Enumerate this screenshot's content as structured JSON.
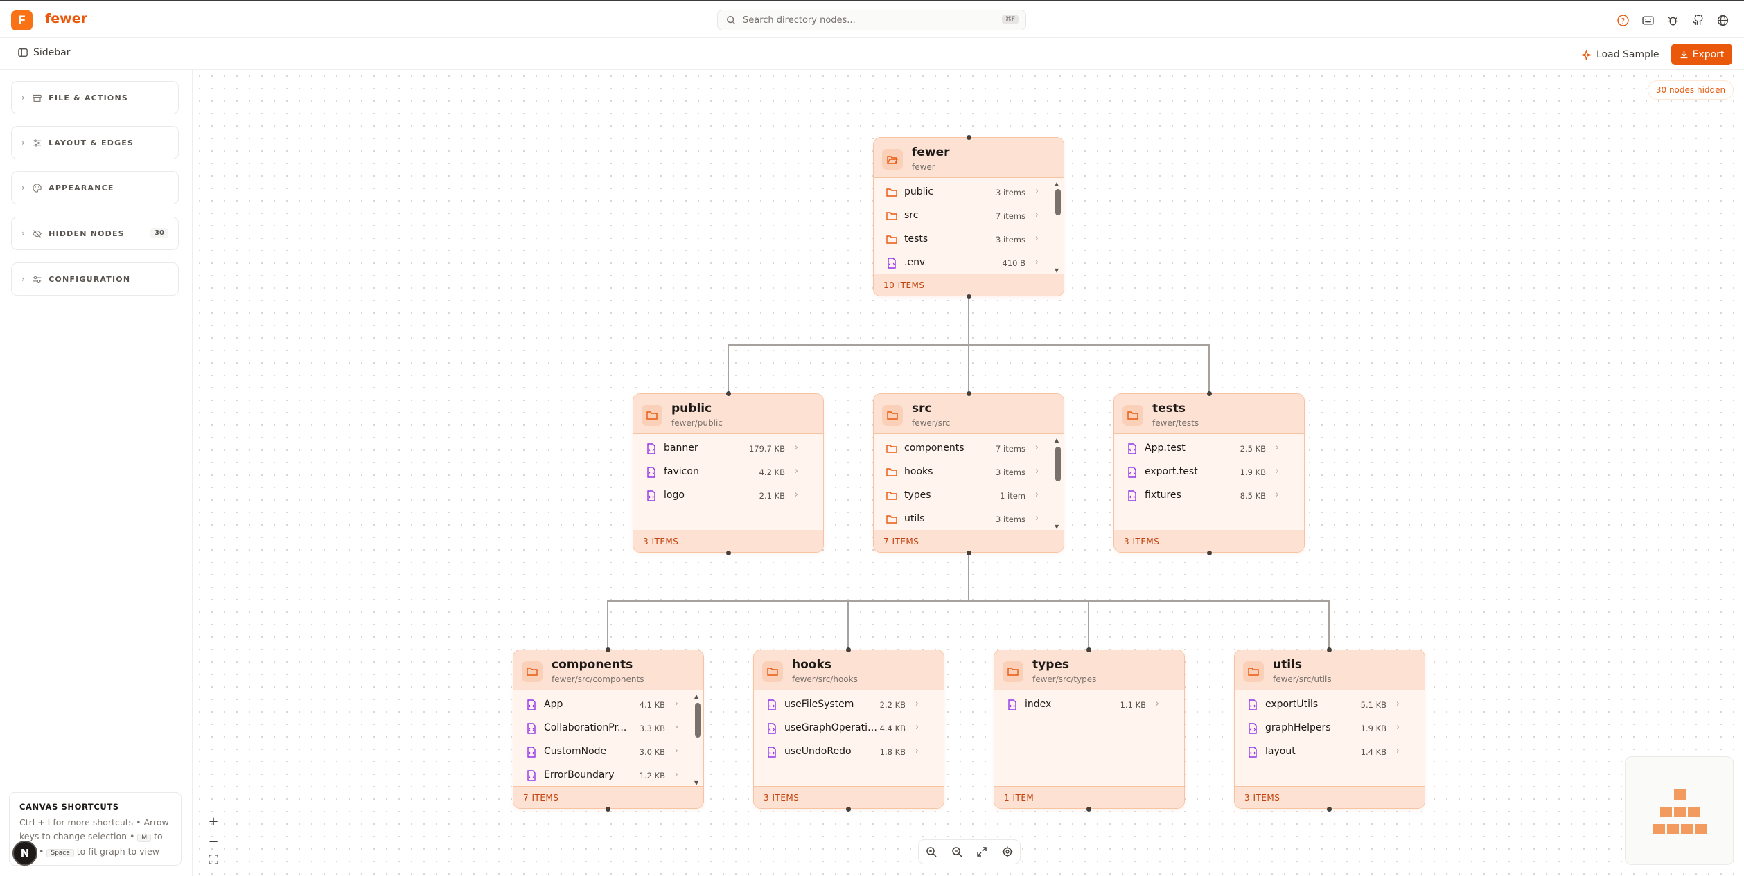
{
  "app": {
    "name": "fewer",
    "logo_letter": "F"
  },
  "search": {
    "placeholder": "Search directory nodes...",
    "shortcut": "⌘F"
  },
  "topbar_icons": [
    "help-icon",
    "keyboard-icon",
    "bug-icon",
    "github-icon",
    "globe-icon"
  ],
  "subbar": {
    "sidebar_label": "Sidebar",
    "load_sample_label": "Load Sample",
    "export_label": "Export"
  },
  "sidebar": {
    "sections": [
      {
        "label": "FILE & ACTIONS",
        "icon": "archive-icon"
      },
      {
        "label": "LAYOUT & EDGES",
        "icon": "sliders-icon"
      },
      {
        "label": "APPEARANCE",
        "icon": "palette-icon"
      },
      {
        "label": "HIDDEN NODES",
        "icon": "eye-off-icon",
        "badge": "30"
      },
      {
        "label": "CONFIGURATION",
        "icon": "settings-icon"
      }
    ],
    "shortcuts": {
      "title": "CANVAS SHORTCUTS",
      "line1": "Ctrl + I for more shortcuts • Arrow",
      "line2a": "keys to change selection •",
      "key1": "M",
      "line2b": "to",
      "line3a": "•",
      "key2": "Space",
      "line3b": "to fit graph to view"
    },
    "avatar": "N"
  },
  "canvas": {
    "hidden_badge": "30 nodes hidden"
  },
  "colors": {
    "accent": "#ea580c",
    "node_bg": "#fff4ee",
    "node_header": "#fde1d3",
    "file_icon": "#9333ea"
  },
  "nodes": {
    "fewer": {
      "name": "fewer",
      "path": "fewer",
      "footer": "10 ITEMS",
      "rows": [
        {
          "type": "folder",
          "name": "public",
          "size": "3 items"
        },
        {
          "type": "folder",
          "name": "src",
          "size": "7 items"
        },
        {
          "type": "folder",
          "name": "tests",
          "size": "3 items"
        },
        {
          "type": "file",
          "name": ".env",
          "size": "410 B"
        }
      ]
    },
    "public": {
      "name": "public",
      "path": "fewer/public",
      "footer": "3 ITEMS",
      "rows": [
        {
          "type": "file",
          "name": "banner",
          "size": "179.7 KB"
        },
        {
          "type": "file",
          "name": "favicon",
          "size": "4.2 KB"
        },
        {
          "type": "file",
          "name": "logo",
          "size": "2.1 KB"
        }
      ]
    },
    "src": {
      "name": "src",
      "path": "fewer/src",
      "footer": "7 ITEMS",
      "rows": [
        {
          "type": "folder",
          "name": "components",
          "size": "7 items"
        },
        {
          "type": "folder",
          "name": "hooks",
          "size": "3 items"
        },
        {
          "type": "folder",
          "name": "types",
          "size": "1 item"
        },
        {
          "type": "folder",
          "name": "utils",
          "size": "3 items"
        }
      ]
    },
    "tests": {
      "name": "tests",
      "path": "fewer/tests",
      "footer": "3 ITEMS",
      "rows": [
        {
          "type": "file",
          "name": "App.test",
          "size": "2.5 KB"
        },
        {
          "type": "file",
          "name": "export.test",
          "size": "1.9 KB"
        },
        {
          "type": "file",
          "name": "fixtures",
          "size": "8.5 KB"
        }
      ]
    },
    "components": {
      "name": "components",
      "path": "fewer/src/components",
      "footer": "7 ITEMS",
      "rows": [
        {
          "type": "file",
          "name": "App",
          "size": "4.1 KB"
        },
        {
          "type": "file",
          "name": "CollaborationPr...",
          "size": "3.3 KB"
        },
        {
          "type": "file",
          "name": "CustomNode",
          "size": "3.0 KB"
        },
        {
          "type": "file",
          "name": "ErrorBoundary",
          "size": "1.2 KB"
        }
      ]
    },
    "hooks": {
      "name": "hooks",
      "path": "fewer/src/hooks",
      "footer": "3 ITEMS",
      "rows": [
        {
          "type": "file",
          "name": "useFileSystem",
          "size": "2.2 KB"
        },
        {
          "type": "file",
          "name": "useGraphOperatio...",
          "size": "4.4 KB"
        },
        {
          "type": "file",
          "name": "useUndoRedo",
          "size": "1.8 KB"
        }
      ]
    },
    "types": {
      "name": "types",
      "path": "fewer/src/types",
      "footer": "1 ITEM",
      "rows": [
        {
          "type": "file",
          "name": "index",
          "size": "1.1 KB"
        }
      ]
    },
    "utils": {
      "name": "utils",
      "path": "fewer/src/utils",
      "footer": "3 ITEMS",
      "rows": [
        {
          "type": "file",
          "name": "exportUtils",
          "size": "5.1 KB"
        },
        {
          "type": "file",
          "name": "graphHelpers",
          "size": "1.9 KB"
        },
        {
          "type": "file",
          "name": "layout",
          "size": "1.4 KB"
        }
      ]
    }
  }
}
